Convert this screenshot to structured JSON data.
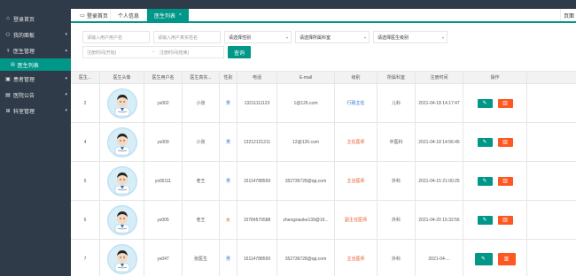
{
  "sidebar": {
    "items": [
      {
        "label": "登录首页",
        "icon": "home-icon",
        "glyph": "⌂"
      },
      {
        "label": "我的面板",
        "icon": "panel-icon",
        "glyph": "⚇"
      },
      {
        "label": "医生管理",
        "icon": "doctor-icon",
        "glyph": "⚕"
      },
      {
        "label": "医生列表",
        "icon": "list-icon",
        "glyph": "▤",
        "sub": true,
        "active": true
      },
      {
        "label": "患者管理",
        "icon": "patient-icon",
        "glyph": "▣"
      },
      {
        "label": "医院公告",
        "icon": "notice-icon",
        "glyph": "▤"
      },
      {
        "label": "科室管理",
        "icon": "dept-icon",
        "glyph": "⊞"
      }
    ]
  },
  "tabs": {
    "home": "登录首页",
    "items": [
      {
        "label": "个人信息",
        "active": false
      },
      {
        "label": "医生列表",
        "active": true
      }
    ],
    "right_label": "页面"
  },
  "filters": {
    "username_placeholder": "请输入用户用户名",
    "realname_placeholder": "请输入用户真实姓名",
    "gender_select": "请选择性别",
    "dept_select": "请选择所属科室",
    "level_select": "请选择医生级别",
    "date_start_placeholder": "注册时间(开始)",
    "date_end_placeholder": "注册时间(结束)",
    "search_label": "查询"
  },
  "table": {
    "headers": [
      "医生...",
      "医生头像",
      "医生用户名",
      "医生真实...",
      "性别",
      "电话",
      "E-mail",
      "级别",
      "所属科室",
      "注册时间",
      "操作"
    ],
    "rows": [
      {
        "id": "2",
        "username": "ys002",
        "realname": "小张",
        "gender": "男",
        "gender_class": "gender-m",
        "phone": "13211111123",
        "email": "1@126.com",
        "level": "行政主任",
        "level_class": "lvl-blue",
        "dept": "儿科",
        "time": "2021-04-18 14:17:47"
      },
      {
        "id": "4",
        "username": "ys009",
        "realname": "小张",
        "gender": "男",
        "gender_class": "gender-m",
        "phone": "13212121211",
        "email": "12@126.com",
        "level": "主任医师",
        "level_class": "lvl-red",
        "dept": "中医科",
        "time": "2021-04-18 14:56:45"
      },
      {
        "id": "5",
        "username": "ys00111",
        "realname": "老王",
        "gender": "男",
        "gender_class": "gender-m",
        "phone": "15114788599",
        "email": "352736728@qq.com",
        "level": "主治医师",
        "level_class": "lvl-red",
        "dept": "外科",
        "time": "2021-04-15 21:00:25"
      },
      {
        "id": "6",
        "username": "ys005",
        "realname": "老王",
        "gender": "女",
        "gender_class": "gender-f",
        "phone": "15784579588",
        "email": "zhengxiaoke139@16...",
        "level": "副主任医师",
        "level_class": "lvl-red",
        "dept": "外科",
        "time": "2021-04-20 15:32:56"
      },
      {
        "id": "7",
        "username": "ys047",
        "realname": "张医生",
        "gender": "男",
        "gender_class": "gender-m",
        "phone": "15114788599",
        "email": "352736728@qq.com",
        "level": "主治医师",
        "level_class": "lvl-red",
        "dept": "外科",
        "time": "2021-04-..."
      }
    ]
  },
  "icons": {
    "edit": "✎",
    "delete": "▥",
    "monitor": "▭",
    "chevron": "▾",
    "close": "×"
  },
  "colors": {
    "primary": "#009688",
    "danger": "#ff5722",
    "sidebar": "#2f3b48"
  }
}
